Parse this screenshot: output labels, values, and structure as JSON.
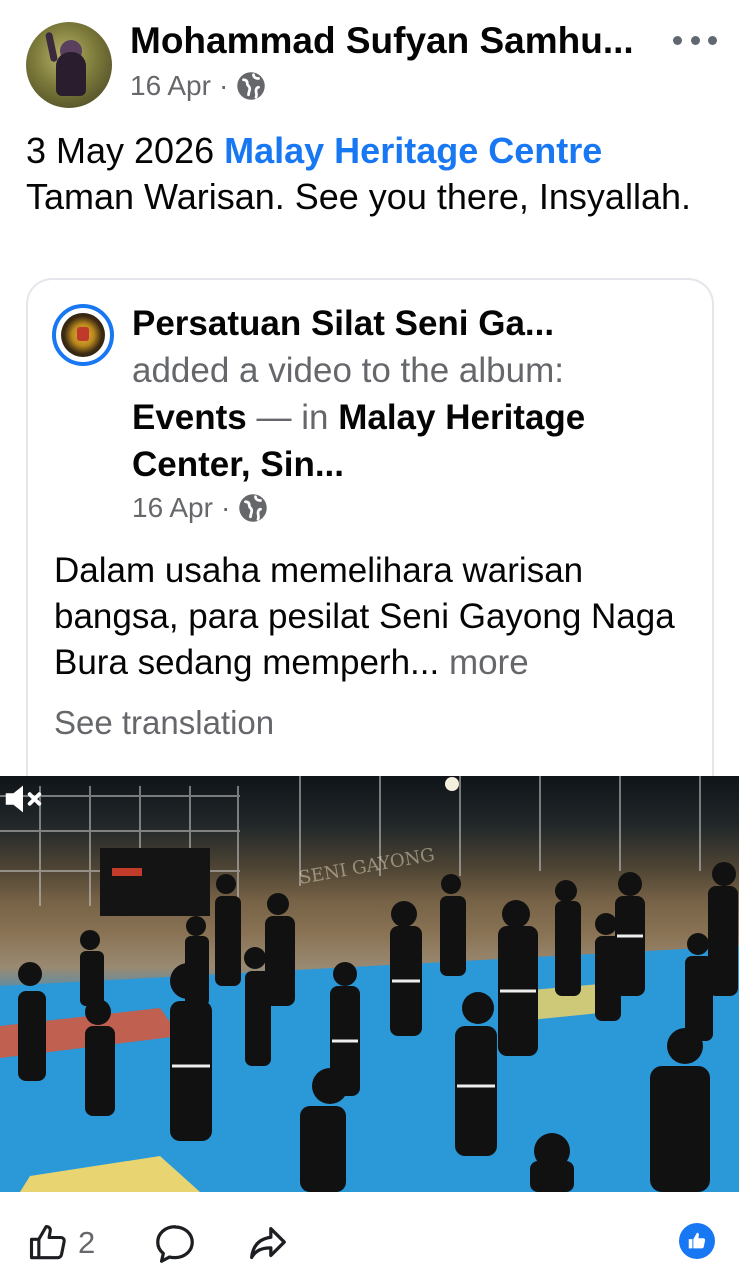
{
  "post": {
    "author": "Mohammad Sufyan Samhu...",
    "date": "16 Apr",
    "separator": "·",
    "privacy_icon": "globe-icon",
    "more_icon": "more-horizontal-icon",
    "text_prefix": "3 May 2026 ",
    "location_link": "Malay Heritage Centre",
    "text_suffix": " Taman Warisan. See you there, Insyallah."
  },
  "shared": {
    "page_name": "Persatuan Silat Seni Ga...",
    "action_text": "added a video to the album:",
    "album": "Events",
    "in_text": " — in ",
    "location": "Malay Heritage Center, Sin...",
    "date": "16 Apr",
    "separator": "·",
    "privacy_icon": "globe-icon",
    "body": "Dalam usaha memelihara warisan bangsa, para pesilat Seni Gayong Naga Bura sedang memperh... ",
    "more_label": "more",
    "translation_label": "See translation"
  },
  "video": {
    "watermark": "SENI GAYONG",
    "mute_icon": "muted-speaker-icon"
  },
  "actions": {
    "like_icon": "thumbs-up-icon",
    "like_count": "2",
    "comment_icon": "comment-icon",
    "share_icon": "share-icon",
    "reaction_icon": "like-reaction-icon"
  },
  "colors": {
    "link": "#1877f2",
    "secondary_text": "#65676b",
    "primary_text": "#050505",
    "mat_blue": "#2a94d6"
  }
}
